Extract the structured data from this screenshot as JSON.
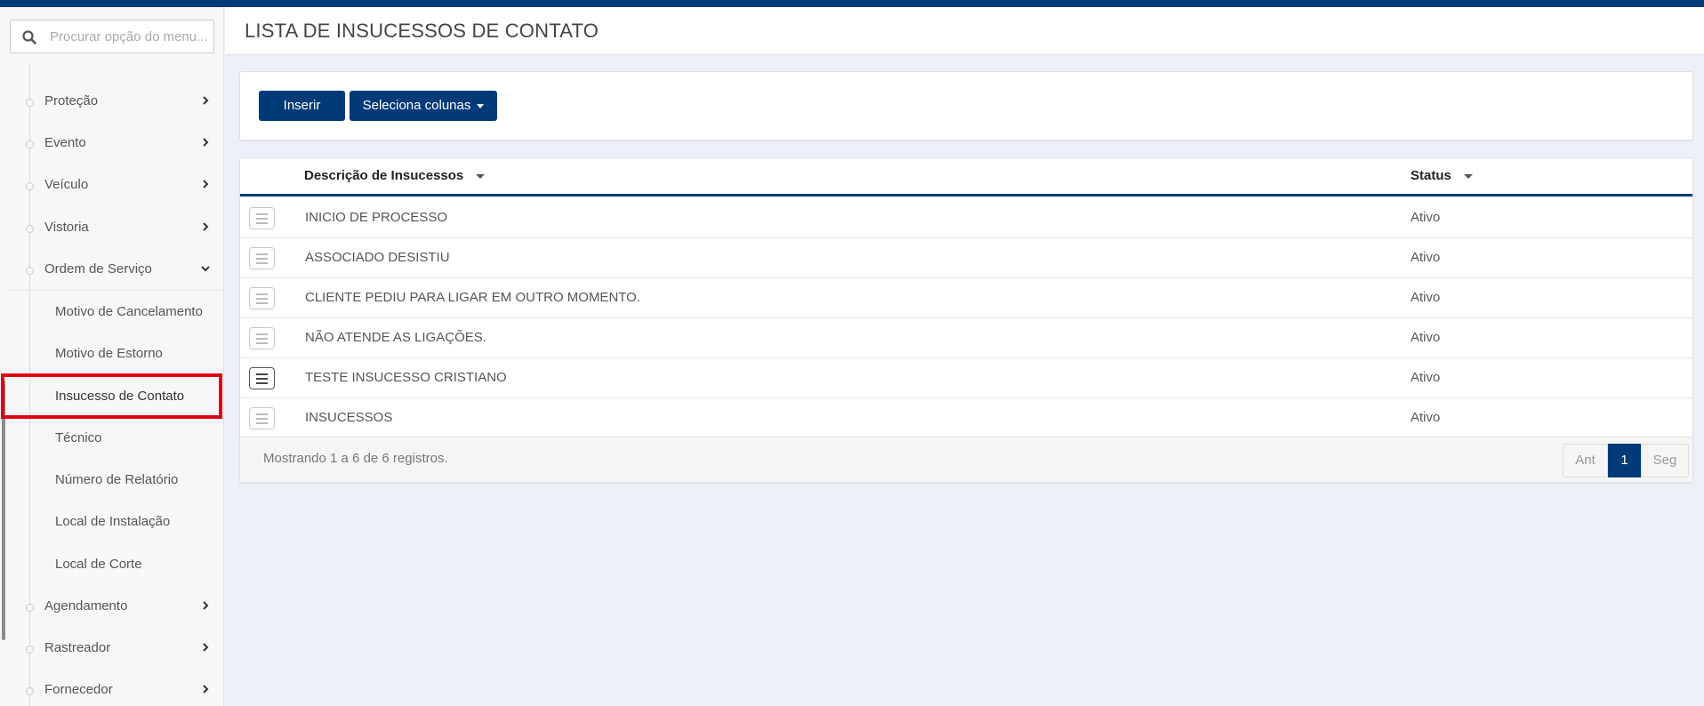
{
  "sidebar": {
    "search_placeholder": "Procurar opção do menu...",
    "items": [
      {
        "label": "Proteção"
      },
      {
        "label": "Evento"
      },
      {
        "label": "Veículo"
      },
      {
        "label": "Vistoria"
      },
      {
        "label": "Ordem de Serviço"
      },
      {
        "label": "Agendamento"
      },
      {
        "label": "Rastreador"
      },
      {
        "label": "Fornecedor"
      }
    ],
    "subitems": [
      {
        "label": "Motivo de Cancelamento"
      },
      {
        "label": "Motivo de Estorno"
      },
      {
        "label": "Insucesso de Contato"
      },
      {
        "label": "Técnico"
      },
      {
        "label": "Número de Relatório"
      },
      {
        "label": "Local de Instalação"
      },
      {
        "label": "Local de Corte"
      }
    ],
    "active_item": "Insucesso de Contato"
  },
  "header": {
    "title": "LISTA DE INSUCESSOS DE CONTATO"
  },
  "toolbar": {
    "insert_label": "Inserir",
    "columns_label": "Seleciona colunas"
  },
  "table": {
    "columns": [
      "Descrição de Insucessos",
      "Status"
    ],
    "rows": [
      {
        "description": "INICIO DE PROCESSO",
        "status": "Ativo"
      },
      {
        "description": "ASSOCIADO DESISTIU",
        "status": "Ativo"
      },
      {
        "description": "CLIENTE PEDIU PARA LIGAR EM OUTRO MOMENTO.",
        "status": "Ativo"
      },
      {
        "description": "NÃO ATENDE AS LIGAÇÕES.",
        "status": "Ativo"
      },
      {
        "description": "TESTE INSUCESSO CRISTIANO",
        "status": "Ativo"
      },
      {
        "description": "INSUCESSOS",
        "status": "Ativo"
      }
    ],
    "summary": "Mostrando 1 a 6 de 6 registros."
  },
  "pagination": {
    "prev": "Ant",
    "current": "1",
    "next": "Seg"
  },
  "colors": {
    "brand": "#003a78",
    "highlight": "#e00012",
    "background": "#eef0f8"
  },
  "icons": {
    "search": "search-icon",
    "chevron": "chevron-right-icon",
    "row_menu": "hamburger-menu-icon"
  }
}
